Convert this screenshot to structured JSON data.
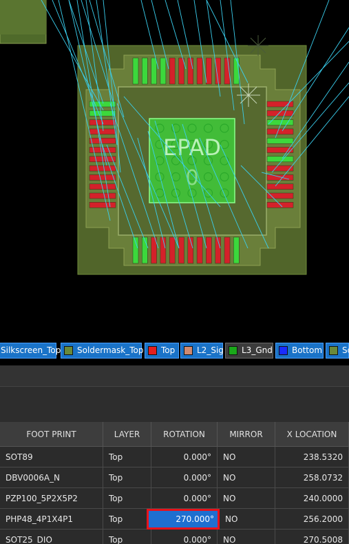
{
  "canvas": {
    "component_label": "EPAD",
    "pad_number": "0"
  },
  "layers": [
    {
      "label": "Silkscreen_Top",
      "color": ""
    },
    {
      "label": "Soldermask_Top",
      "color": "#6a8a3a"
    },
    {
      "label": "Top",
      "color": "#e41e1e"
    },
    {
      "label": "L2_Sig",
      "color": "#d08a70"
    },
    {
      "label": "L3_Gnd",
      "color": "#1aa81a"
    },
    {
      "label": "Bottom",
      "color": "#1a2cff"
    },
    {
      "label": "So",
      "color": "#6a8a3a"
    }
  ],
  "table": {
    "columns": [
      "FOOT PRINT",
      "LAYER",
      "ROTATION",
      "MIRROR",
      "X LOCATION"
    ],
    "rows": [
      {
        "footprint": "SOT89",
        "layer": "Top",
        "rotation": "0.000°",
        "mirror": "NO",
        "x": "238.5320"
      },
      {
        "footprint": "DBV0006A_N",
        "layer": "Top",
        "rotation": "0.000°",
        "mirror": "NO",
        "x": "258.0732"
      },
      {
        "footprint": "PZP100_5P2X5P2",
        "layer": "Top",
        "rotation": "0.000°",
        "mirror": "NO",
        "x": "240.0000"
      },
      {
        "footprint": "PHP48_4P1X4P1",
        "layer": "Top",
        "rotation": "270.000°",
        "mirror": "NO",
        "x": "256.2000"
      },
      {
        "footprint": "SOT25_DIO",
        "layer": "Top",
        "rotation": "0.000°",
        "mirror": "NO",
        "x": "270.5008"
      }
    ],
    "selected_row": 3
  }
}
